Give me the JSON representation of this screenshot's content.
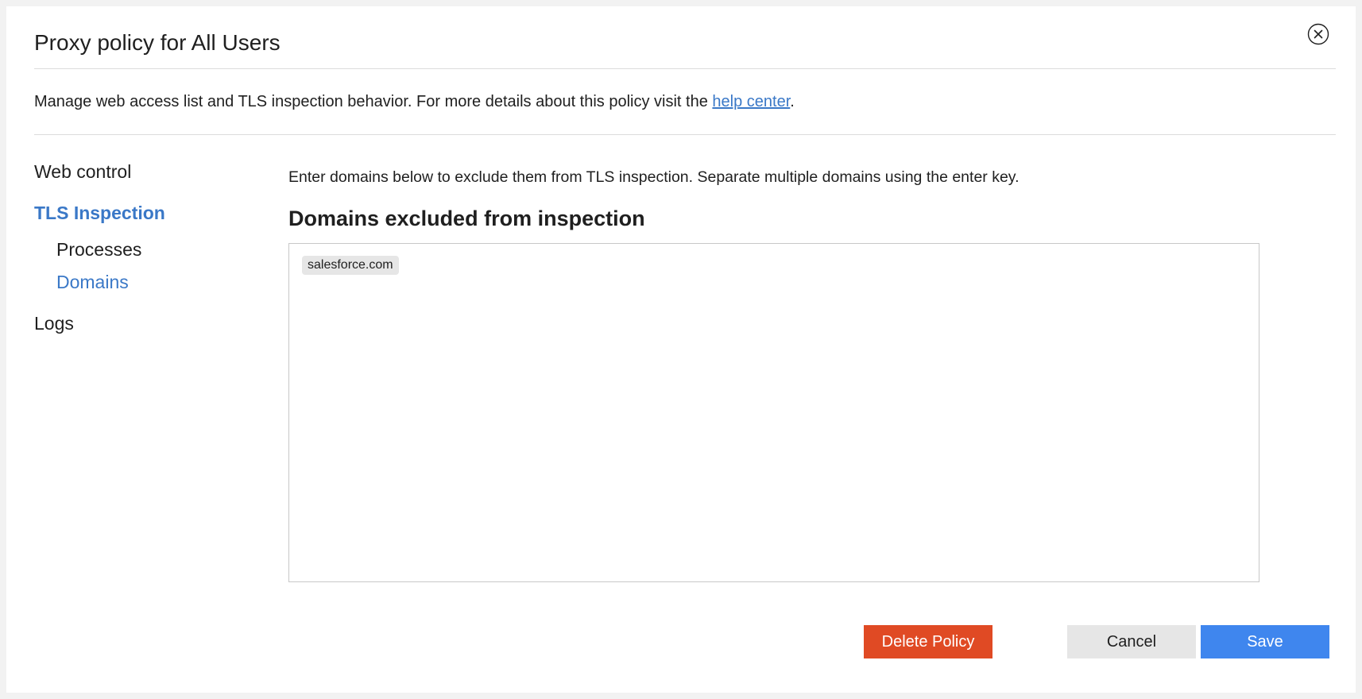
{
  "dialog": {
    "title": "Proxy policy for All Users",
    "close_icon": "close-circle-icon",
    "description_prefix": "Manage web access list and TLS inspection behavior. For more details about this policy visit the ",
    "description_link": "help center",
    "description_suffix": "."
  },
  "sidebar": {
    "items": [
      {
        "label": "Web control"
      },
      {
        "label": "TLS Inspection"
      },
      {
        "label": "Processes"
      },
      {
        "label": "Domains"
      },
      {
        "label": "Logs"
      }
    ],
    "active_parent": "TLS Inspection",
    "active_child": "Domains"
  },
  "main": {
    "intro": "Enter domains below to exclude them from TLS inspection. Separate multiple domains using the enter key.",
    "heading": "Domains excluded from inspection",
    "domains": [
      "salesforce.com"
    ]
  },
  "footer": {
    "delete_label": "Delete Policy",
    "cancel_label": "Cancel",
    "save_label": "Save"
  },
  "colors": {
    "accent": "#3a78c7",
    "delete": "#e04a24",
    "save": "#3f86ee",
    "cancel": "#e6e6e6"
  }
}
